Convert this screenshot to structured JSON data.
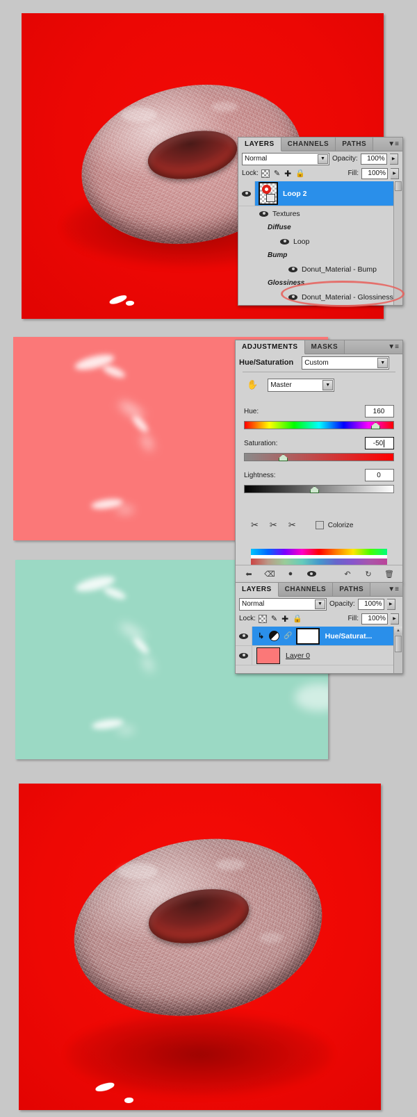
{
  "images": {
    "top_render": {
      "name": "textured red donut render",
      "bg_color": "#ee0804"
    },
    "pink_canvas": {
      "name": "glossiness map pink",
      "color": "#fb7878"
    },
    "mint_canvas": {
      "name": "glossiness map hue shifted mint",
      "color": "#9bd9c4"
    },
    "bottom_render": {
      "name": "textured donut render after adjustment",
      "bg_color": "#ee0804"
    }
  },
  "layers_panel_top": {
    "tabs": [
      {
        "label": "LAYERS",
        "active": true
      },
      {
        "label": "CHANNELS",
        "active": false
      },
      {
        "label": "PATHS",
        "active": false
      }
    ],
    "menu_icon": "panel-menu-icon",
    "blend_mode": "Normal",
    "opacity_label": "Opacity:",
    "opacity_value": "100%",
    "lock_label": "Lock:",
    "lock_icons": [
      "transparency-lock-icon",
      "brush-lock-icon",
      "move-lock-icon",
      "all-lock-icon"
    ],
    "fill_label": "Fill:",
    "fill_value": "100%",
    "rows": [
      {
        "label": "Loop 2",
        "type": "layer",
        "selected": true,
        "indent": 0,
        "eye": true
      },
      {
        "label": "Textures",
        "type": "group",
        "selected": false,
        "indent": 1,
        "eye": true
      },
      {
        "label": "Diffuse",
        "type": "italic-header",
        "selected": false,
        "indent": 1,
        "eye": false
      },
      {
        "label": "Loop",
        "type": "texture",
        "selected": false,
        "indent": 2,
        "eye": true
      },
      {
        "label": "Bump",
        "type": "italic-header",
        "selected": false,
        "indent": 1,
        "eye": false
      },
      {
        "label": "Donut_Material - Bump",
        "type": "texture",
        "selected": false,
        "indent": 2,
        "eye": true
      },
      {
        "label": "Glossiness",
        "type": "italic-header",
        "selected": false,
        "indent": 1,
        "eye": false
      },
      {
        "label": "Donut_Material - Glossiness",
        "type": "texture",
        "selected": false,
        "indent": 2,
        "eye": true,
        "annotated": true
      }
    ],
    "annotation": {
      "shape": "red-ellipse-highlight",
      "color": "#e8605c",
      "target": "Donut_Material - Glossiness"
    }
  },
  "adjustments_panel": {
    "tabs": [
      {
        "label": "ADJUSTMENTS",
        "active": true
      },
      {
        "label": "MASKS",
        "active": false
      }
    ],
    "menu_icon": "panel-menu-icon",
    "title": "Hue/Saturation",
    "preset": "Custom",
    "channel": "Master",
    "hand_tool_icon": "on-image-adjust-icon",
    "sliders": [
      {
        "label": "Hue:",
        "value": "160",
        "thumb_pct": 89
      },
      {
        "label": "Saturation:",
        "value": "-50",
        "thumb_pct": 23,
        "editing": true
      },
      {
        "label": "Lightness:",
        "value": "0",
        "thumb_pct": 50
      }
    ],
    "eyedroppers": [
      "eyedropper-icon",
      "eyedropper-add-icon",
      "eyedropper-subtract-icon"
    ],
    "colorize_label": "Colorize",
    "colorize_checked": false,
    "toolbar_icons": [
      "return-to-adjustment-list-icon",
      "clip-to-layer-icon",
      "toggle-layer-visibility-icon",
      "preview-eye-icon",
      "reset-to-previous-icon",
      "reset-adjustment-icon",
      "delete-adjustment-layer-icon"
    ]
  },
  "layers_panel_bottom": {
    "tabs": [
      {
        "label": "LAYERS",
        "active": true
      },
      {
        "label": "CHANNELS",
        "active": false
      },
      {
        "label": "PATHS",
        "active": false
      }
    ],
    "menu_icon": "panel-menu-icon",
    "blend_mode": "Normal",
    "opacity_label": "Opacity:",
    "opacity_value": "100%",
    "lock_label": "Lock:",
    "fill_label": "Fill:",
    "fill_value": "100%",
    "rows": [
      {
        "label": "Hue/Saturat...",
        "selected": true,
        "eye": true,
        "kind": "adjustment",
        "icons": [
          "clip-arrow-icon",
          "hue-saturation-icon",
          "link-icon"
        ],
        "has_mask": true
      },
      {
        "label": "Layer 0",
        "selected": false,
        "eye": true,
        "kind": "pixel",
        "thumb_color": "#fb7878"
      }
    ]
  },
  "colors": {
    "app_background": "#c8c8c8",
    "panel_background": "#d2d2d2",
    "selection_blue": "#2a8fea",
    "annotation_red": "#e8605c"
  }
}
